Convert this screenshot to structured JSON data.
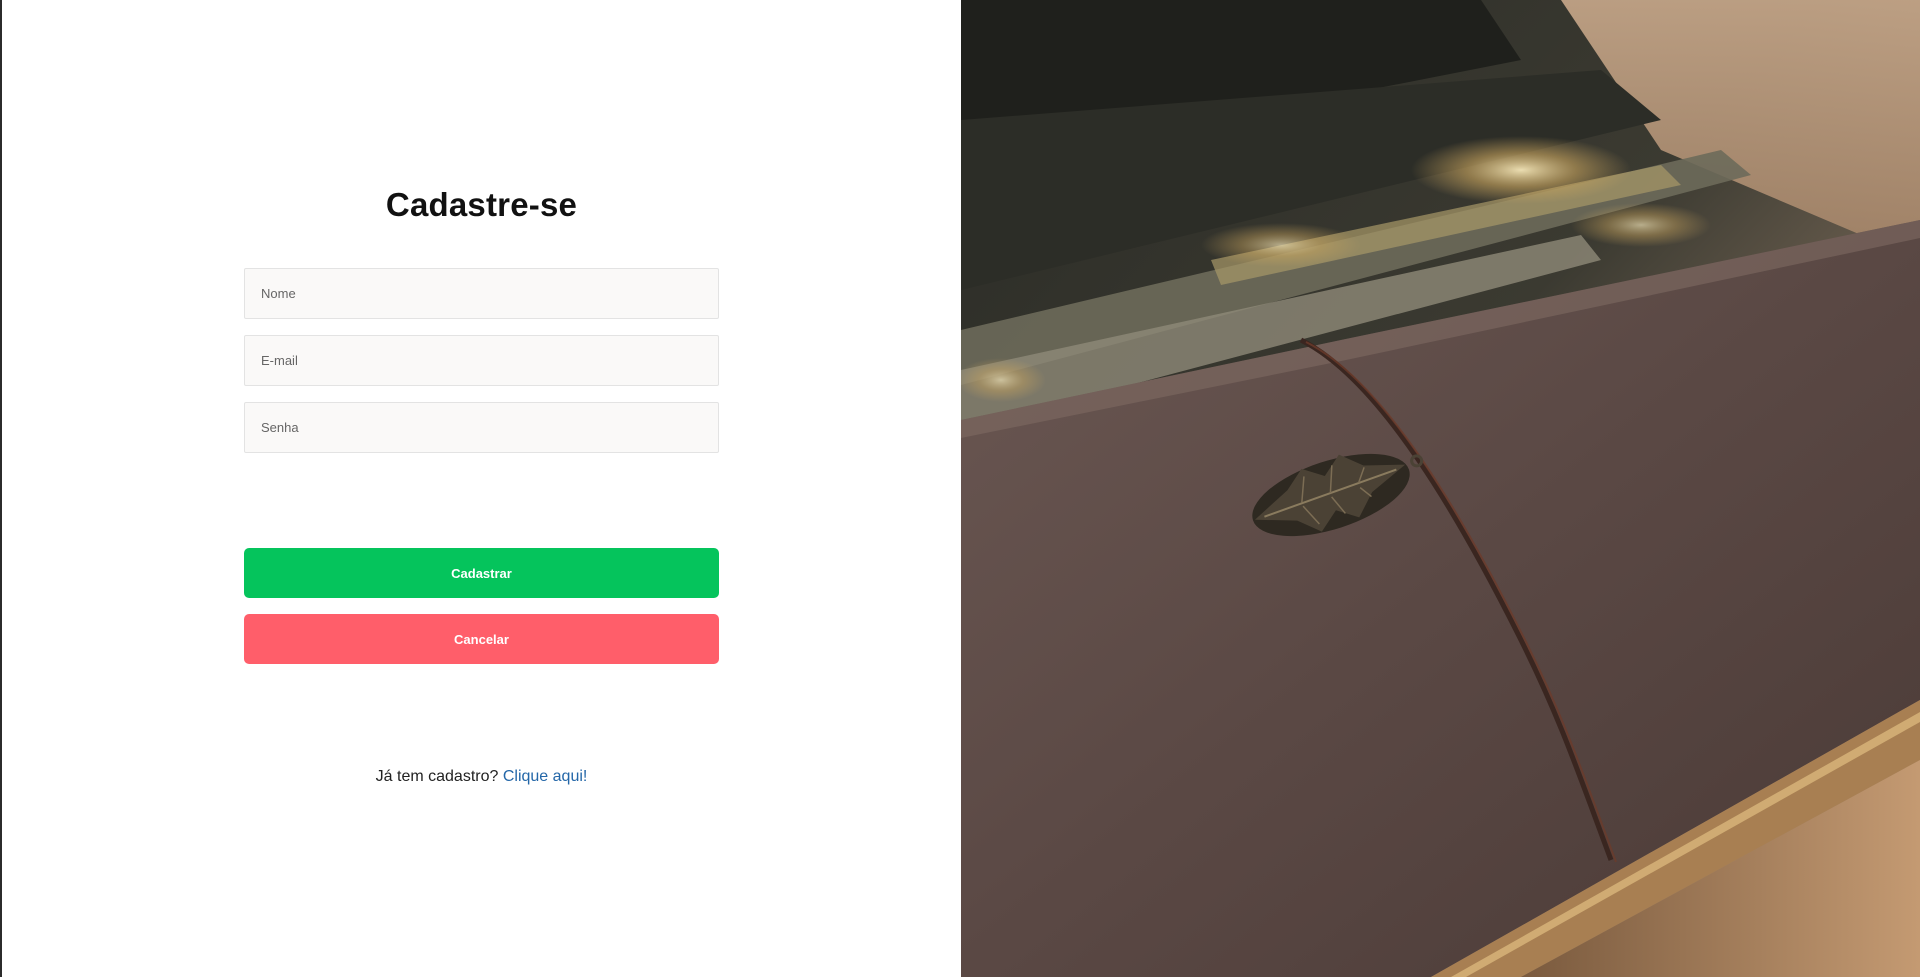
{
  "form": {
    "title": "Cadastre-se",
    "fields": {
      "name_placeholder": "Nome",
      "email_placeholder": "E-mail",
      "password_placeholder": "Senha"
    },
    "buttons": {
      "submit_label": "Cadastrar",
      "cancel_label": "Cancelar"
    },
    "login_prompt": {
      "text": "Já tem cadastro?",
      "link_text": "Clique aqui!"
    }
  },
  "colors": {
    "submit_button": "#05c45c",
    "cancel_button": "#ff5e6a",
    "link": "#2467a8",
    "field_background": "#faf9f8"
  }
}
